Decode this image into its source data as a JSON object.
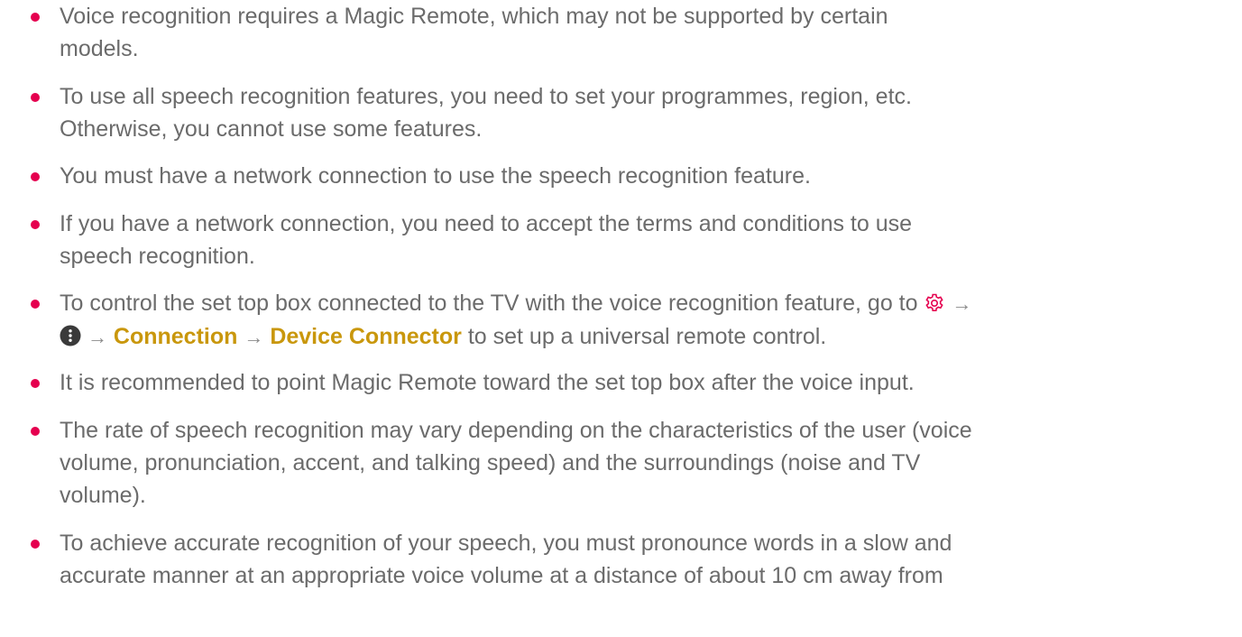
{
  "notes": [
    {
      "lines": [
        "Voice recognition requires a Magic Remote, which may not be supported by certain",
        "models."
      ]
    },
    {
      "lines": [
        "To use all speech recognition features, you need to set your programmes, region, etc.",
        "Otherwise, you cannot use some features."
      ]
    },
    {
      "lines": [
        "You must have a network connection to use the speech recognition feature."
      ]
    },
    {
      "lines": [
        "If you have a network connection, you need to accept the terms and conditions to use",
        "speech recognition."
      ]
    },
    {
      "line1": "To control the set top box connected to the TV with the voice recognition feature, go to",
      "arrow": "→",
      "path": [
        "Connection",
        "Device Connector"
      ],
      "tail": "to set up a universal remote control."
    },
    {
      "lines": [
        "It is recommended to point Magic Remote toward the set top box after the voice input."
      ]
    },
    {
      "lines": [
        "The rate of speech recognition may vary depending on the characteristics of the user (voice",
        "volume, pronunciation, accent, and talking speed) and the surroundings (noise and TV",
        "volume)."
      ]
    },
    {
      "lines": [
        "To achieve accurate recognition of your speech, you must pronounce words in a slow and",
        "accurate manner at an appropriate voice volume at a distance of about 10 cm away from"
      ]
    }
  ],
  "icons": {
    "settings": "gear-icon",
    "more": "more-options-icon"
  },
  "colors": {
    "bullet": "#e5004f",
    "highlight": "#c9970c",
    "text": "#6b6b6b",
    "gear": "#e5004f"
  }
}
